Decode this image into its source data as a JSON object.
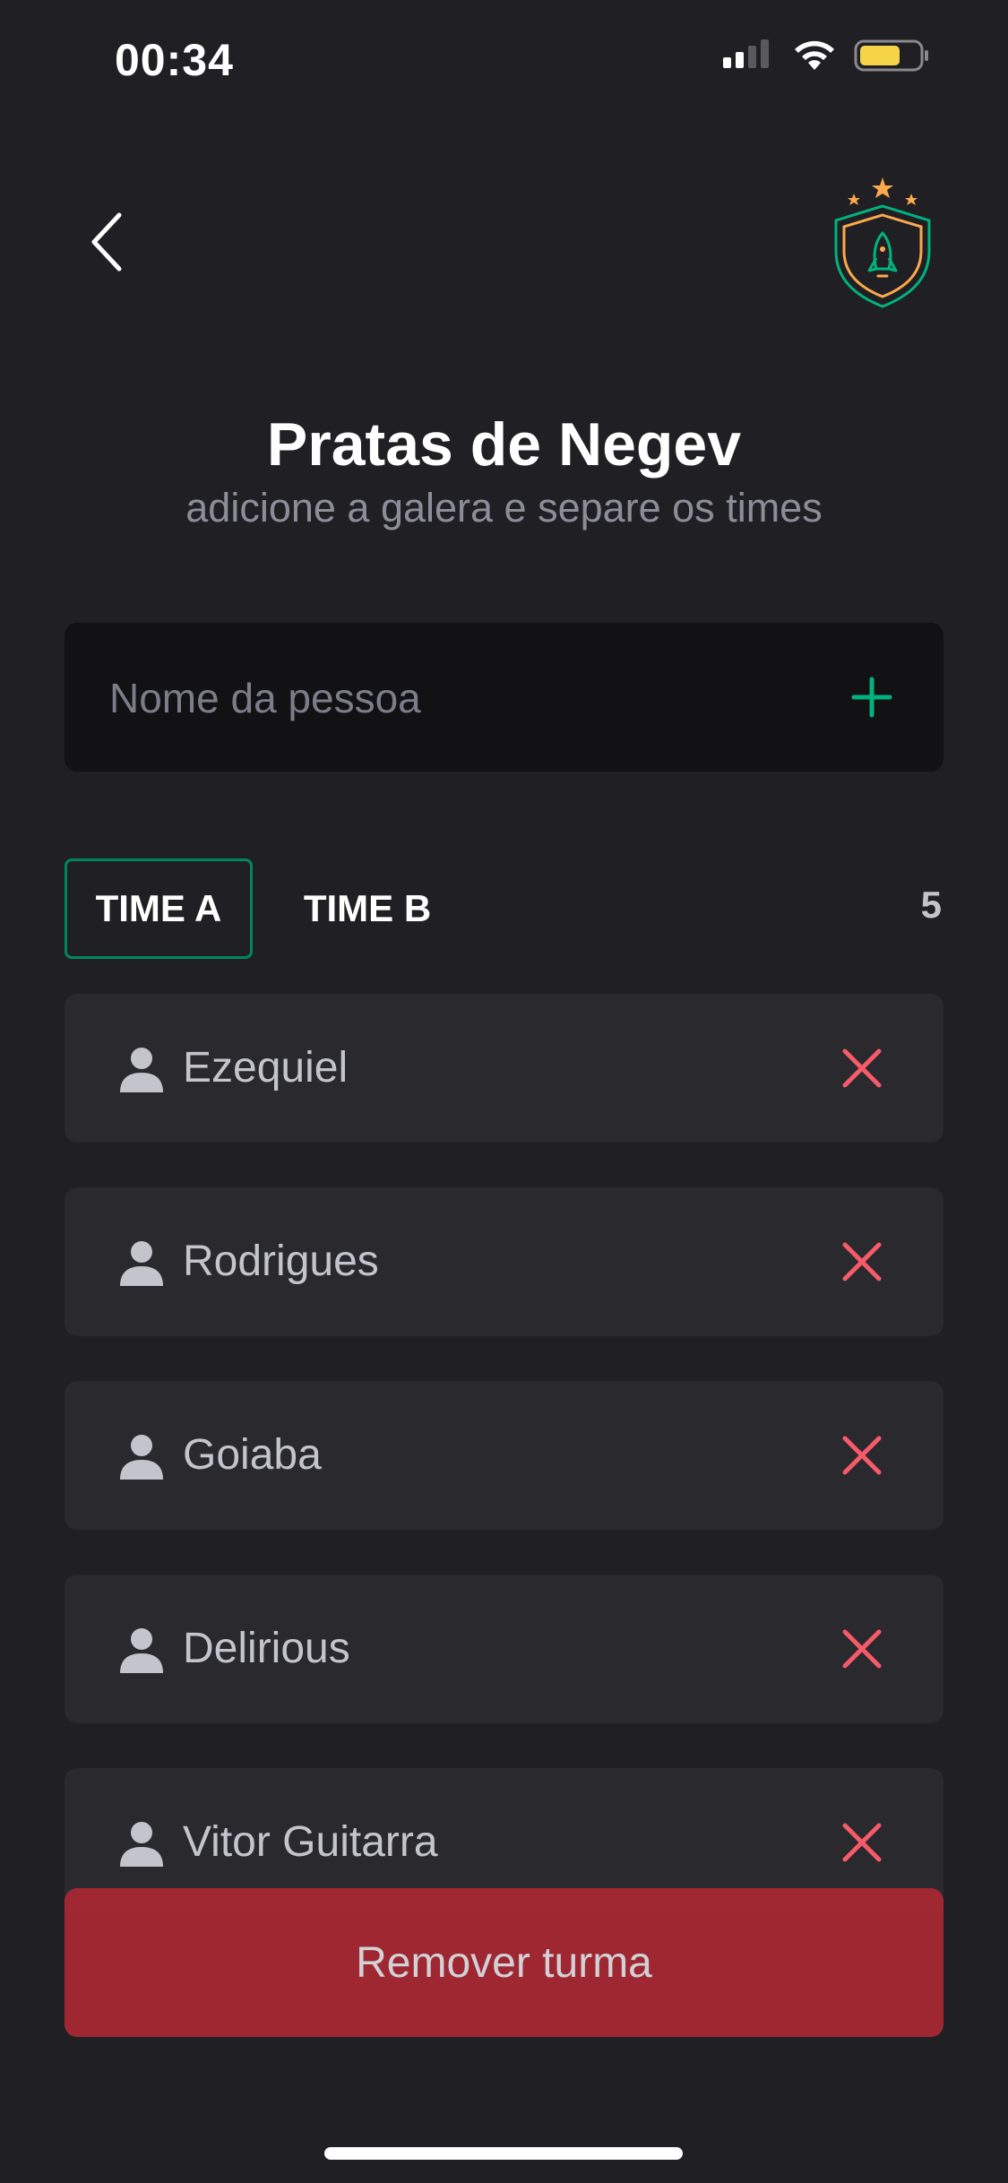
{
  "status_bar": {
    "time": "00:34"
  },
  "header": {
    "back_icon": "chevron-left-icon",
    "logo_icon": "rocket-shield-logo"
  },
  "title": {
    "text": "Pratas de Negev",
    "subtitle": "adicione a galera e separe os times"
  },
  "add_form": {
    "placeholder": "Nome da pessoa",
    "value": "",
    "add_icon": "plus-icon"
  },
  "tabs": [
    {
      "label": "TIME A",
      "active": true
    },
    {
      "label": "TIME B",
      "active": false
    }
  ],
  "players_count": "5",
  "players": [
    {
      "name": "Ezequiel"
    },
    {
      "name": "Rodrigues"
    },
    {
      "name": "Goiaba"
    },
    {
      "name": "Delirious"
    },
    {
      "name": "Vitor Guitarra"
    }
  ],
  "remove_class_label": "Remover turma",
  "colors": {
    "background": "#202024",
    "card": "#29292E",
    "input_bg": "#121214",
    "accent_green": "#00875F",
    "danger_red": "#F75A68",
    "danger_button": "#AA2834",
    "logo_orange": "#FBA94C"
  }
}
